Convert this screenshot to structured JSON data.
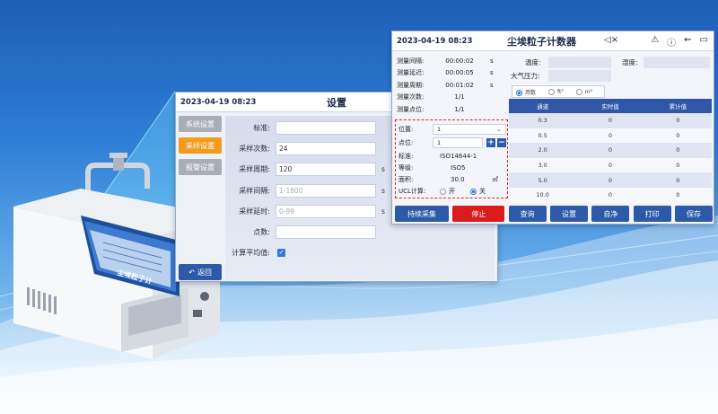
{
  "settings": {
    "datetime": "2023-04-19 08:23",
    "title": "设置",
    "tabs": [
      "系统设置",
      "采样设置",
      "报警设置"
    ],
    "back_label": "返回",
    "fields": [
      {
        "label": "标准:",
        "value": "",
        "placeholder": "",
        "unit": ""
      },
      {
        "label": "采样次数:",
        "value": "24",
        "placeholder": "",
        "unit": ""
      },
      {
        "label": "采样周期:",
        "value": "120",
        "placeholder": "",
        "unit": "s"
      },
      {
        "label": "采样间隔:",
        "value": "",
        "placeholder": "1-1800",
        "unit": "s"
      },
      {
        "label": "采样延时:",
        "value": "",
        "placeholder": "0-99",
        "unit": "s"
      },
      {
        "label": "点数:",
        "value": "",
        "placeholder": "",
        "unit": ""
      }
    ],
    "average_label": "计算平均值:",
    "average_checked": true
  },
  "main": {
    "datetime": "2023-04-19 08:23",
    "title": "尘埃粒子计数器",
    "info": [
      {
        "key": "测量间隔:",
        "value": "00:00:02",
        "unit": "s"
      },
      {
        "key": "测量延迟:",
        "value": "00:00:05",
        "unit": "s"
      },
      {
        "key": "测量周期:",
        "value": "00:01:02",
        "unit": "s"
      },
      {
        "key": "测量次数:",
        "value": "1/1",
        "unit": ""
      },
      {
        "key": "测量点位:",
        "value": "1/1",
        "unit": ""
      }
    ],
    "params": {
      "position_label": "位置:",
      "position_value": "1",
      "point_label": "点位:",
      "point_value": "1",
      "standard_label": "标准:",
      "standard_value": "ISO14644-1",
      "grade_label": "等级:",
      "grade_value": "ISO5",
      "area_label": "面积:",
      "area_value": "30.0",
      "area_unit": "㎡",
      "ucl_label": "UCL计算:",
      "ucl_on": "开",
      "ucl_off": "关",
      "ucl_selected": "off"
    },
    "env": {
      "temp_label": "温度:",
      "humidity_label": "湿度:",
      "pressure_label": "大气压力:"
    },
    "units": [
      "用数",
      "ft³",
      "m³"
    ],
    "table": {
      "headers": [
        "通道",
        "实时值",
        "累计值"
      ],
      "rows": [
        [
          "0.3",
          "0",
          "0"
        ],
        [
          "0.5",
          "0",
          "0"
        ],
        [
          "2.0",
          "0",
          "0"
        ],
        [
          "3.0",
          "0",
          "0"
        ],
        [
          "5.0",
          "0",
          "0"
        ],
        [
          "10.0",
          "0",
          "0"
        ]
      ]
    },
    "buttons": [
      "持续采集",
      "停止",
      "查询",
      "设置",
      "自净",
      "打印",
      "保存"
    ]
  },
  "device": {
    "screen_title": "尘埃粒子计"
  },
  "colors": {
    "primary": "#2c5aa8",
    "header_bar": "#3056a8",
    "stop": "#d91b1b",
    "active_tab": "#f39a1f",
    "inactive_tab": "#a9adb5",
    "highlight_border": "#d82b2b"
  }
}
